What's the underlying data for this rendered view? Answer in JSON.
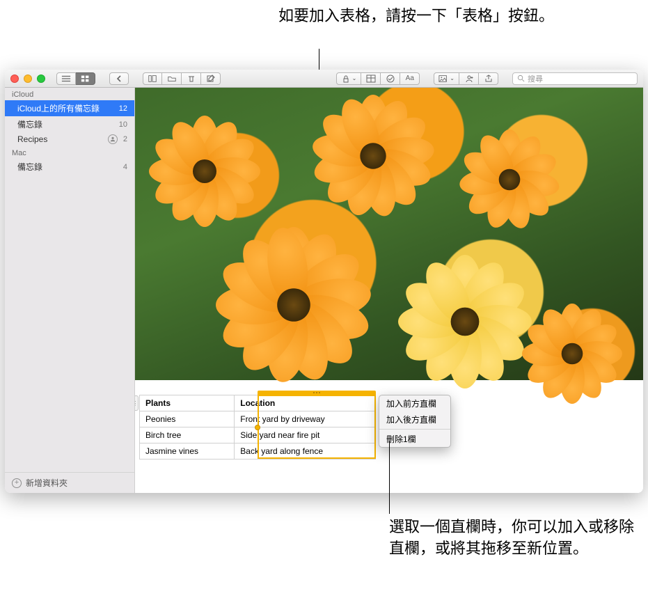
{
  "callouts": {
    "top": "如要加入表格，請按一下「表格」按鈕。",
    "bottom": "選取一個直欄時，你可以加入或移除直欄，或將其拖移至新位置。"
  },
  "toolbar": {
    "search_placeholder": "搜尋"
  },
  "sidebar": {
    "sections": [
      {
        "header": "iCloud",
        "items": [
          {
            "label": "iCloud上的所有備忘錄",
            "count": "12",
            "selected": true
          },
          {
            "label": "備忘錄",
            "count": "10"
          },
          {
            "label": "Recipes",
            "count": "2",
            "shared": true
          }
        ]
      },
      {
        "header": "Mac",
        "items": [
          {
            "label": "備忘錄",
            "count": "4"
          }
        ]
      }
    ],
    "footer": "新增資料夾"
  },
  "table": {
    "headers": [
      "Plants",
      "Location"
    ],
    "rows": [
      [
        "Peonies",
        "Front yard by driveway"
      ],
      [
        "Birch tree",
        "Side yard near fire pit"
      ],
      [
        "Jasmine vines",
        "Back yard along fence"
      ]
    ]
  },
  "context_menu": {
    "items": [
      "加入前方直欄",
      "加入後方直欄"
    ],
    "items2": [
      "刪除1欄"
    ]
  }
}
